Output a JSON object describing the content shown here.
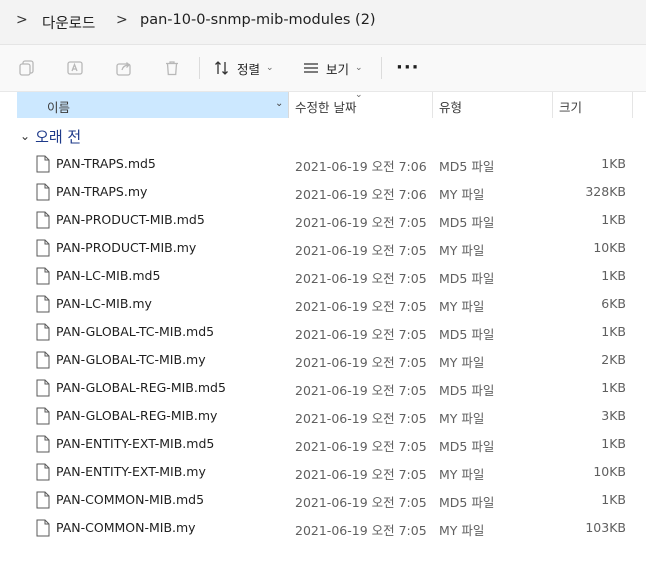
{
  "breadcrumb": {
    "items": [
      "다운로드",
      "pan-10-0-snmp-mib-modules (2)"
    ]
  },
  "toolbar": {
    "sort_label": "정렬",
    "view_label": "보기",
    "more_label": "···",
    "icons": [
      "copy-icon",
      "rename-icon",
      "share-icon",
      "delete-icon"
    ]
  },
  "columns": {
    "name": "이름",
    "modified": "수정한 날짜",
    "type": "유형",
    "size": "크기"
  },
  "group": {
    "label": "오래 전"
  },
  "files": [
    {
      "name": "PAN-TRAPS.md5",
      "date": "2021-06-19 오전 7:06",
      "type": "MD5 파일",
      "size": "1KB"
    },
    {
      "name": "PAN-TRAPS.my",
      "date": "2021-06-19 오전 7:06",
      "type": "MY 파일",
      "size": "328KB"
    },
    {
      "name": "PAN-PRODUCT-MIB.md5",
      "date": "2021-06-19 오전 7:05",
      "type": "MD5 파일",
      "size": "1KB"
    },
    {
      "name": "PAN-PRODUCT-MIB.my",
      "date": "2021-06-19 오전 7:05",
      "type": "MY 파일",
      "size": "10KB"
    },
    {
      "name": "PAN-LC-MIB.md5",
      "date": "2021-06-19 오전 7:05",
      "type": "MD5 파일",
      "size": "1KB"
    },
    {
      "name": "PAN-LC-MIB.my",
      "date": "2021-06-19 오전 7:05",
      "type": "MY 파일",
      "size": "6KB"
    },
    {
      "name": "PAN-GLOBAL-TC-MIB.md5",
      "date": "2021-06-19 오전 7:05",
      "type": "MD5 파일",
      "size": "1KB"
    },
    {
      "name": "PAN-GLOBAL-TC-MIB.my",
      "date": "2021-06-19 오전 7:05",
      "type": "MY 파일",
      "size": "2KB"
    },
    {
      "name": "PAN-GLOBAL-REG-MIB.md5",
      "date": "2021-06-19 오전 7:05",
      "type": "MD5 파일",
      "size": "1KB"
    },
    {
      "name": "PAN-GLOBAL-REG-MIB.my",
      "date": "2021-06-19 오전 7:05",
      "type": "MY 파일",
      "size": "3KB"
    },
    {
      "name": "PAN-ENTITY-EXT-MIB.md5",
      "date": "2021-06-19 오전 7:05",
      "type": "MD5 파일",
      "size": "1KB"
    },
    {
      "name": "PAN-ENTITY-EXT-MIB.my",
      "date": "2021-06-19 오전 7:05",
      "type": "MY 파일",
      "size": "10KB"
    },
    {
      "name": "PAN-COMMON-MIB.md5",
      "date": "2021-06-19 오전 7:05",
      "type": "MD5 파일",
      "size": "1KB"
    },
    {
      "name": "PAN-COMMON-MIB.my",
      "date": "2021-06-19 오전 7:05",
      "type": "MY 파일",
      "size": "103KB"
    }
  ],
  "colors": {
    "selected_header": "#cce8ff",
    "group_label": "#1e3a8a"
  }
}
